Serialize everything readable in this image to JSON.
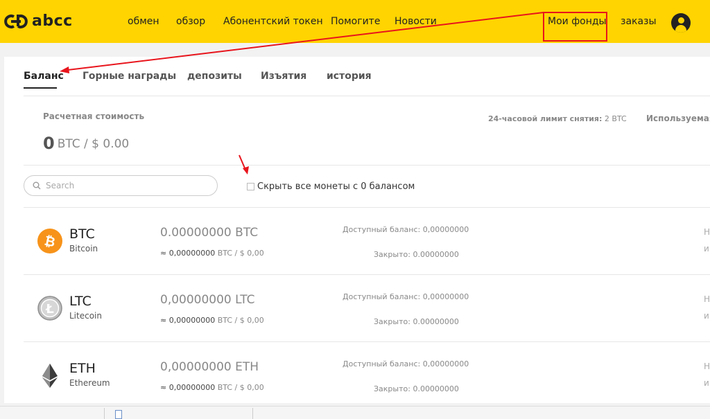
{
  "header": {
    "logo_text": "abcc",
    "nav": [
      {
        "label": "обмен"
      },
      {
        "label": "обзор"
      },
      {
        "label": "Абонентский токен"
      },
      {
        "label": "Помогите"
      },
      {
        "label": "Новости"
      }
    ],
    "my_funds": "Мои фонды",
    "orders": "заказы",
    "accent_color": "#ffd400"
  },
  "tabs": [
    {
      "label": "Баланс",
      "active": true
    },
    {
      "label": "Горные награды"
    },
    {
      "label": "депозиты"
    },
    {
      "label": "Изъятия"
    },
    {
      "label": "история"
    }
  ],
  "summary": {
    "label": "Расчетная стоимость",
    "value_zero": "0",
    "value_rest": "BTC / $ 0.00",
    "limit_label": "24-часовой лимит снятия:",
    "limit_value": "2 BTC",
    "used_label": "Используемая"
  },
  "filters": {
    "search_placeholder": "Search",
    "hide_zero_label": "Скрыть все монеты с 0 балансом"
  },
  "coins": [
    {
      "symbol": "BTC",
      "name": "Bitcoin",
      "amount": "0.00000000",
      "amount_unit": "BTC",
      "approx_prefix": "≈ 0,00000000",
      "approx_suffix": "BTC / $ 0,00",
      "available": "Доступный баланс: 0,00000000",
      "closed": "Закрыто: 0.00000000",
      "cut1": "Н",
      "cut2": "и",
      "icon": "bitcoin-icon"
    },
    {
      "symbol": "LTC",
      "name": "Litecoin",
      "amount": "0,00000000",
      "amount_unit": "LTC",
      "approx_prefix": "≈ 0,00000000",
      "approx_suffix": "BTC / $ 0,00",
      "available": "Доступный баланс: 0,00000000",
      "closed": "Закрыто: 0.00000000",
      "cut1": "Н",
      "cut2": "и",
      "icon": "litecoin-icon"
    },
    {
      "symbol": "ETH",
      "name": "Ethereum",
      "amount": "0,00000000",
      "amount_unit": "ETH",
      "approx_prefix": "≈ 0,00000000",
      "approx_suffix": "BTC / $ 0,00",
      "available": "Доступный баланс: 0,00000000",
      "closed": "Закрыто: 0.00000000",
      "cut1": "Н",
      "cut2": "и",
      "icon": "ethereum-icon"
    }
  ]
}
